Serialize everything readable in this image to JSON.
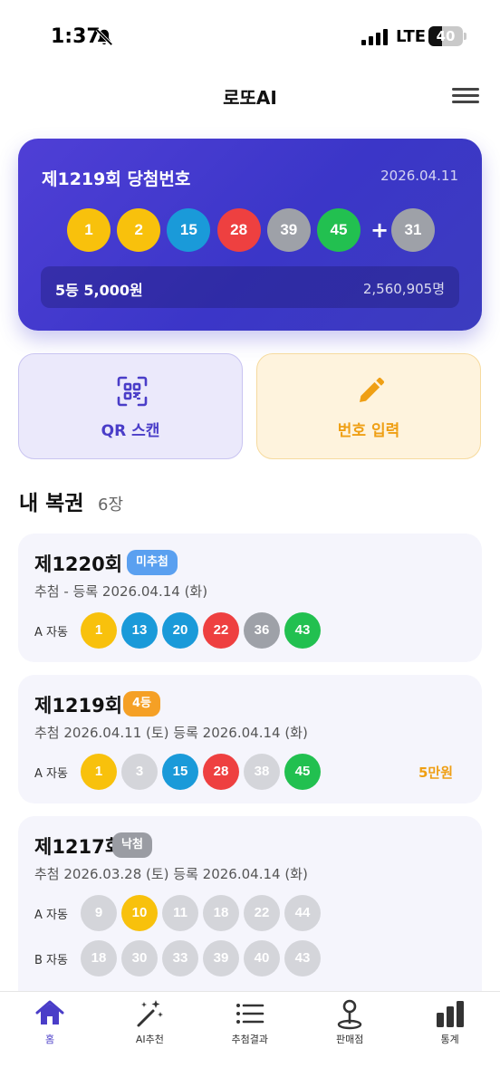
{
  "status": {
    "time": "1:37",
    "network": "LTE",
    "battery": "40",
    "battery_level": 0.4
  },
  "header": {
    "title": "로또AI"
  },
  "latest_draw": {
    "title": "제1219회 당첨번호",
    "date": "2026.04.11",
    "numbers": [
      "1",
      "2",
      "15",
      "28",
      "39",
      "45"
    ],
    "plus": "+",
    "bonus": "31",
    "prize_label": "5등 5,000원",
    "winner_count": "2,560,905명"
  },
  "actions": {
    "qr_label": "QR 스캔",
    "input_label": "번호 입력"
  },
  "tickets_section": {
    "title": "내 복권",
    "count": "6장"
  },
  "tickets": [
    {
      "round": "제1220회",
      "badge": "미추첨",
      "dates": "추첨 -   등록 2026.04.14 (화)",
      "lines": [
        {
          "label": "A 자동",
          "numbers": [
            "1",
            "13",
            "20",
            "22",
            "36",
            "43"
          ],
          "matched": [
            true,
            true,
            true,
            true,
            true,
            true
          ],
          "prize": ""
        }
      ]
    },
    {
      "round": "제1219회",
      "badge": "4등",
      "dates": "추첨 2026.04.11 (토)   등록 2026.04.14 (화)",
      "lines": [
        {
          "label": "A 자동",
          "numbers": [
            "1",
            "3",
            "15",
            "28",
            "38",
            "45"
          ],
          "matched": [
            true,
            false,
            true,
            true,
            false,
            true
          ],
          "prize": "5만원"
        }
      ]
    },
    {
      "round": "제1217회",
      "badge": "낙첨",
      "dates": "추첨 2026.03.28 (토)   등록 2026.04.14 (화)",
      "lines": [
        {
          "label": "A 자동",
          "numbers": [
            "9",
            "10",
            "11",
            "18",
            "22",
            "44"
          ],
          "matched": [
            false,
            true,
            false,
            false,
            false,
            false
          ],
          "prize": ""
        },
        {
          "label": "B 자동",
          "numbers": [
            "18",
            "30",
            "33",
            "39",
            "40",
            "43"
          ],
          "matched": [
            false,
            false,
            false,
            false,
            false,
            false
          ],
          "prize": ""
        }
      ]
    }
  ],
  "tabs": [
    {
      "label": "홈",
      "icon": "home-icon",
      "active": true
    },
    {
      "label": "AI추천",
      "icon": "magic-wand-icon",
      "active": false
    },
    {
      "label": "추첨결과",
      "icon": "list-icon",
      "active": false
    },
    {
      "label": "판매점",
      "icon": "map-pin-icon",
      "active": false
    },
    {
      "label": "통계",
      "icon": "bar-chart-icon",
      "active": false
    }
  ],
  "colors": {
    "accent": "#4a3dc8",
    "ball_yellow": "#f8c10c",
    "ball_blue": "#1a9ad9",
    "ball_red": "#ee4040",
    "ball_gray": "#9ea1a8",
    "ball_green": "#22c050",
    "ball_unmatched": "#d4d5da",
    "badge_pending": "#5aa0f0",
    "badge_win": "#f5a025",
    "badge_lose": "#9a9ca3",
    "prize": "#ef9f14"
  }
}
